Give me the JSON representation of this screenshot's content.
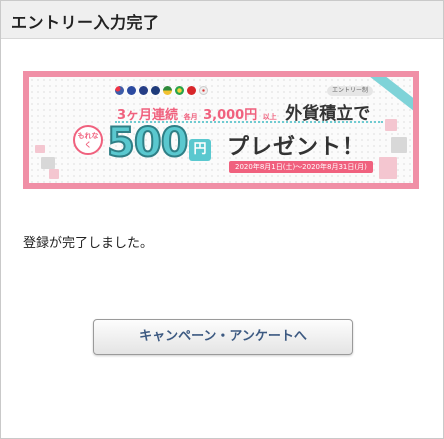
{
  "header": {
    "title": "エントリー入力完了"
  },
  "banner": {
    "flags": [
      {
        "name": "us-flag-icon",
        "color": "#3d5ca8"
      },
      {
        "name": "eu-flag-icon",
        "color": "#2b4aa0"
      },
      {
        "name": "au-flag-icon",
        "color": "#263e86"
      },
      {
        "name": "nz-flag-icon",
        "color": "#1f3b7a"
      },
      {
        "name": "za-flag-icon",
        "color": "#2e8a3a"
      },
      {
        "name": "br-flag-icon",
        "color": "#2aa34a"
      },
      {
        "name": "cn-flag-icon",
        "color": "#d8262a"
      },
      {
        "name": "kr-flag-icon",
        "color": "#e0e0e0"
      }
    ],
    "entry_tag": "エントリー制",
    "months_label": "3ヶ月連続",
    "each_month_label": "各月",
    "amount_label": "3,000円",
    "above_label": "以上",
    "savings_label": "外貨積立で",
    "bubble_text": "もれなく",
    "prize_amount": "500",
    "yen": "円",
    "present_text": "プレゼント！",
    "date_range": "2020年8月1日(土)～2020年8月31日(月)",
    "accent_color": "#f0617e",
    "teal_color": "#5ac8cf"
  },
  "main": {
    "message": "登録が完了しました。",
    "cta_label": "キャンペーン・アンケートへ"
  }
}
